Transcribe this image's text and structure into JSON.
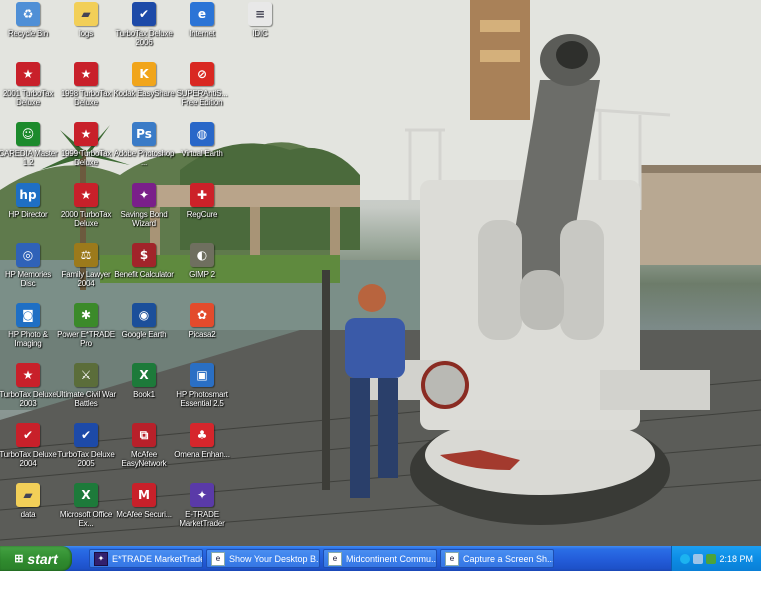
{
  "desktop": {
    "icons": [
      {
        "label": "Recycle Bin",
        "icon": "recycle-bin-icon",
        "color": "#4f8fd6"
      },
      {
        "label": "logs",
        "icon": "folder-icon",
        "color": "#f2cf58"
      },
      {
        "label": "TurboTax Deluxe 2006",
        "icon": "turbotax-icon",
        "color": "#1d4aa8"
      },
      {
        "label": "Internet",
        "icon": "internet-explorer-icon",
        "color": "#2b74d6"
      },
      {
        "label": "IDIC",
        "icon": "document-icon",
        "color": "#e8e8e8"
      },
      {
        "label": "2001 TurboTax Deluxe",
        "icon": "uncle-sam-hat-icon",
        "color": "#c8202a"
      },
      {
        "label": "1998 TurboTax Deluxe",
        "icon": "turbotax-setup-icon",
        "color": "#c8202a"
      },
      {
        "label": "Kodak EasyShare",
        "icon": "kodak-icon",
        "color": "#f1a51b"
      },
      {
        "label": "SUPERAntiS... Free Edition",
        "icon": "no-sign-icon",
        "color": "#d92822"
      },
      {
        "label": "CAREDIA Master 1.2",
        "icon": "green-face-icon",
        "color": "#1c8a2c"
      },
      {
        "label": "1999 TurboTax Deluxe",
        "icon": "turbotax-setup-icon",
        "color": "#c8202a"
      },
      {
        "label": "Adobe Photoshop ...",
        "icon": "photoshop-icon",
        "color": "#3a7bc7"
      },
      {
        "label": "Virtual Earth",
        "icon": "globe-icon",
        "color": "#2967c8"
      },
      {
        "label": "HP Director",
        "icon": "hp-director-icon",
        "color": "#1f6fc4"
      },
      {
        "label": "2000 TurboTax Deluxe",
        "icon": "turbotax-setup-icon",
        "color": "#c8202a"
      },
      {
        "label": "Savings Bond Wizard",
        "icon": "star-icon",
        "color": "#7a1f8a"
      },
      {
        "label": "RegCure",
        "icon": "regcure-icon",
        "color": "#cc2129"
      },
      {
        "label": "HP Memories Disc",
        "icon": "disc-icon",
        "color": "#2f62b8"
      },
      {
        "label": "Family Lawyer 2004",
        "icon": "gavel-icon",
        "color": "#9c7a1b"
      },
      {
        "label": "Benefit Calculator",
        "icon": "calculator-icon",
        "color": "#a1242a"
      },
      {
        "label": "GIMP 2",
        "icon": "gimp-icon",
        "color": "#6f6f5f"
      },
      {
        "label": "HP Photo & Imaging",
        "icon": "camera-icon",
        "color": "#1f6fc4"
      },
      {
        "label": "Power E*TRADE Pro",
        "icon": "etrade-pro-icon",
        "color": "#3b8a2a"
      },
      {
        "label": "Google Earth",
        "icon": "google-earth-icon",
        "color": "#1b4f9a"
      },
      {
        "label": "Picasa2",
        "icon": "picasa-icon",
        "color": "#e34b2c"
      },
      {
        "label": "TurboTax Deluxe 2003",
        "icon": "uncle-sam-hat-icon",
        "color": "#c8202a"
      },
      {
        "label": "Ultimate Civil War Battles",
        "icon": "cannon-icon",
        "color": "#5b6d3a"
      },
      {
        "label": "Book1",
        "icon": "excel-icon",
        "color": "#1d7a3a"
      },
      {
        "label": "HP Photosmart Essential 2.5",
        "icon": "photosmart-icon",
        "color": "#2a6fc4"
      },
      {
        "label": "TurboTax Deluxe 2004",
        "icon": "turbotax-icon",
        "color": "#c8202a"
      },
      {
        "label": "TurboTax Deluxe 2005",
        "icon": "turbotax-icon",
        "color": "#1d4aa8"
      },
      {
        "label": "McAfee EasyNetwork",
        "icon": "mcafee-network-icon",
        "color": "#b8202a"
      },
      {
        "label": "Omena Enhan...",
        "icon": "palm-tree-icon",
        "color": "#d6262c"
      },
      {
        "label": "data",
        "icon": "folder-icon",
        "color": "#f2cf58"
      },
      {
        "label": "Microsoft Office Ex...",
        "icon": "excel-icon",
        "color": "#1d7a3a"
      },
      {
        "label": "McAfee Securi...",
        "icon": "mcafee-icon",
        "color": "#c8202a"
      },
      {
        "label": "E-TRADE MarketTrader",
        "icon": "markettrader-icon",
        "color": "#5a3aa8"
      }
    ]
  },
  "taskbar": {
    "start_label": "start",
    "tasks": [
      {
        "label": "E*TRADE MarketTrader",
        "icon": "markettrader-icon"
      },
      {
        "label": "Show Your Desktop B...",
        "icon": "browser-window-icon"
      },
      {
        "label": "Midcontinent Commu...",
        "icon": "browser-window-icon"
      },
      {
        "label": "Capture a Screen Sh...",
        "icon": "browser-window-icon"
      }
    ],
    "clock": "2:18 PM"
  },
  "colors": {
    "taskbar": "#245edb",
    "start": "#2f8a2e",
    "tray": "#0c8de5"
  }
}
